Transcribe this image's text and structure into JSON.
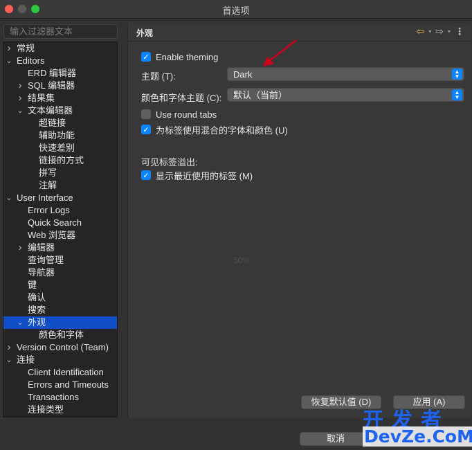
{
  "window": {
    "title": "首选项"
  },
  "filter": {
    "placeholder": "输入过滤器文本"
  },
  "tree": [
    {
      "label": "常规",
      "level": 0,
      "chevron": "right"
    },
    {
      "label": "Editors",
      "level": 0,
      "chevron": "down"
    },
    {
      "label": "ERD 编辑器",
      "level": 1,
      "chevron": "none"
    },
    {
      "label": "SQL 编辑器",
      "level": 1,
      "chevron": "right"
    },
    {
      "label": "结果集",
      "level": 1,
      "chevron": "right"
    },
    {
      "label": "文本编辑器",
      "level": 1,
      "chevron": "down"
    },
    {
      "label": "超链接",
      "level": 2,
      "chevron": "none"
    },
    {
      "label": "辅助功能",
      "level": 2,
      "chevron": "none"
    },
    {
      "label": "快速差别",
      "level": 2,
      "chevron": "none"
    },
    {
      "label": "链接的方式",
      "level": 2,
      "chevron": "none"
    },
    {
      "label": "拼写",
      "level": 2,
      "chevron": "none"
    },
    {
      "label": "注解",
      "level": 2,
      "chevron": "none"
    },
    {
      "label": "User Interface",
      "level": 0,
      "chevron": "down"
    },
    {
      "label": "Error Logs",
      "level": 1,
      "chevron": "none"
    },
    {
      "label": "Quick Search",
      "level": 1,
      "chevron": "none"
    },
    {
      "label": "Web 浏览器",
      "level": 1,
      "chevron": "none"
    },
    {
      "label": "编辑器",
      "level": 1,
      "chevron": "right"
    },
    {
      "label": "查询管理",
      "level": 1,
      "chevron": "none"
    },
    {
      "label": "导航器",
      "level": 1,
      "chevron": "none"
    },
    {
      "label": "键",
      "level": 1,
      "chevron": "none"
    },
    {
      "label": "确认",
      "level": 1,
      "chevron": "none"
    },
    {
      "label": "搜索",
      "level": 1,
      "chevron": "none"
    },
    {
      "label": "外观",
      "level": 1,
      "chevron": "down",
      "selected": true
    },
    {
      "label": "颜色和字体",
      "level": 2,
      "chevron": "none"
    },
    {
      "label": "Version Control (Team)",
      "level": 0,
      "chevron": "right"
    },
    {
      "label": "连接",
      "level": 0,
      "chevron": "down"
    },
    {
      "label": "Client Identification",
      "level": 1,
      "chevron": "none"
    },
    {
      "label": "Errors and Timeouts",
      "level": 1,
      "chevron": "none"
    },
    {
      "label": "Transactions",
      "level": 1,
      "chevron": "none"
    },
    {
      "label": "连接类型",
      "level": 1,
      "chevron": "none"
    }
  ],
  "page": {
    "title": "外观",
    "enable_theming": {
      "label": "Enable theming",
      "checked": true
    },
    "theme": {
      "label": "主题 (T):",
      "value": "Dark"
    },
    "color_font_theme": {
      "label": "颜色和字体主题 (C):",
      "value": "默认（当前）"
    },
    "round_tabs": {
      "label": "Use round tabs",
      "checked": false
    },
    "mixed_fonts": {
      "label": "为标签使用混合的字体和颜色 (U)",
      "checked": true
    },
    "tab_overflow_label": "可见标签溢出:",
    "show_recent_tabs": {
      "label": "显示最近使用的标签 (M)",
      "checked": true
    },
    "progress_text": "50%"
  },
  "buttons": {
    "restore_defaults": "恢复默认值 (D)",
    "apply": "应用 (A)",
    "cancel": "取消"
  },
  "watermark": {
    "top": "开发者",
    "bottom": "DevZe.CoM"
  },
  "colors": {
    "accent": "#0a84ff",
    "selection": "#0f4ec7",
    "annotation_arrow": "#d0021b"
  }
}
